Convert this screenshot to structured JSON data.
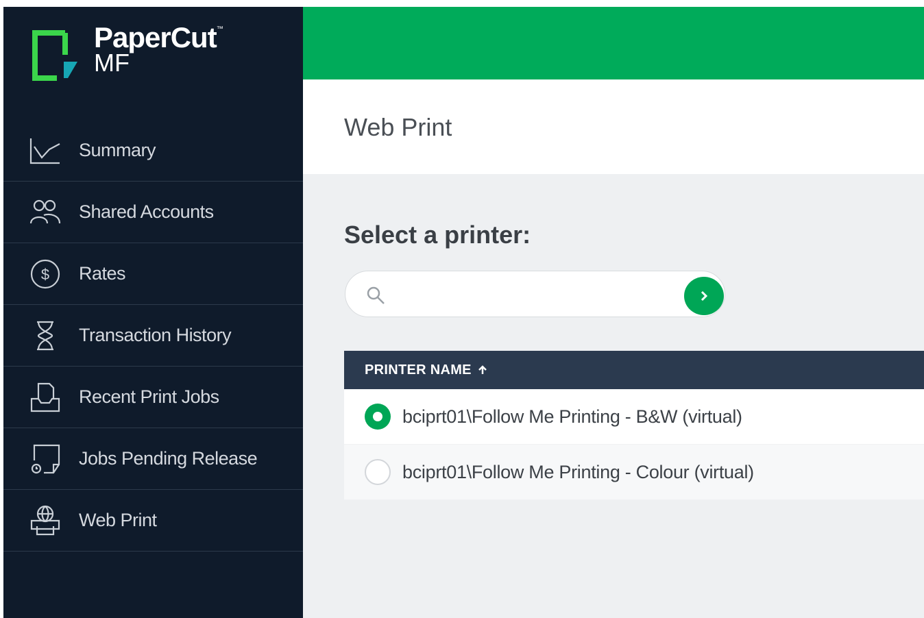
{
  "brand": {
    "name": "PaperCut",
    "tm": "™",
    "product": "MF",
    "colors": {
      "sidebar": "#0f1b2b",
      "topbar": "#00ab5a",
      "accent": "#00a656",
      "table_header": "#2b3a4f"
    }
  },
  "sidebar": {
    "items": [
      {
        "label": "Summary",
        "icon": "chart-line-icon"
      },
      {
        "label": "Shared Accounts",
        "icon": "users-icon"
      },
      {
        "label": "Rates",
        "icon": "dollar-circle-icon"
      },
      {
        "label": "Transaction History",
        "icon": "hourglass-icon"
      },
      {
        "label": "Recent Print Jobs",
        "icon": "print-tray-icon"
      },
      {
        "label": "Jobs Pending Release",
        "icon": "pending-release-icon"
      },
      {
        "label": "Web Print",
        "icon": "web-print-icon"
      }
    ]
  },
  "header": {
    "title": "Web Print"
  },
  "main": {
    "subtitle": "Select a printer:",
    "search": {
      "value": "",
      "placeholder": ""
    },
    "table": {
      "column": "PRINTER NAME",
      "sort": "ascending",
      "rows": [
        {
          "name": "bciprt01\\Follow Me Printing - B&W (virtual)",
          "selected": true
        },
        {
          "name": "bciprt01\\Follow Me Printing - Colour (virtual)",
          "selected": false
        }
      ]
    }
  }
}
